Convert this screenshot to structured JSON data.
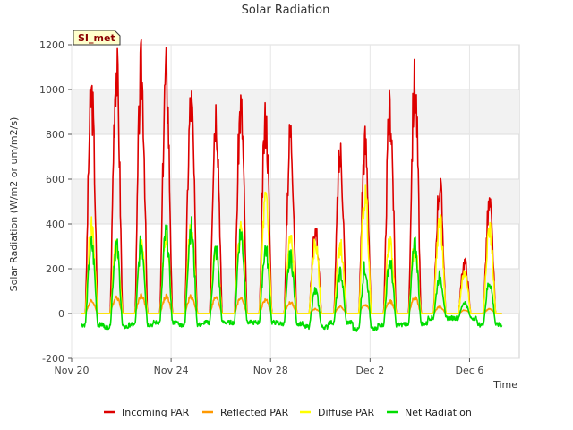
{
  "chart_data": {
    "type": "line",
    "title": "Solar Radiation",
    "xlabel": "Time",
    "ylabel": "Solar Radiation (W/m2 or um/m2/s)",
    "site_label": "SI_met",
    "ylim": [
      -200,
      1200
    ],
    "yticks": [
      -200,
      0,
      200,
      400,
      600,
      800,
      1000,
      1200
    ],
    "xlim": [
      0,
      18
    ],
    "xticks": [
      {
        "day": 0,
        "label": "Nov 20"
      },
      {
        "day": 4,
        "label": "Nov 24"
      },
      {
        "day": 8,
        "label": "Nov 28"
      },
      {
        "day": 12,
        "label": "Dec 2"
      },
      {
        "day": 16,
        "label": "Dec 6"
      }
    ],
    "x_unit": "days since Nov 20",
    "grid": true,
    "legend_position": "bottom",
    "daily_series_note": "x values are day midpoints of solar noon",
    "days": [
      0.8,
      1.8,
      2.8,
      3.8,
      4.8,
      5.8,
      6.8,
      7.8,
      8.8,
      9.8,
      10.8,
      11.8,
      12.8,
      13.8,
      14.8,
      15.8,
      16.8
    ],
    "series": [
      {
        "name": "Incoming PAR",
        "color": "#dd0000",
        "daily_peak": [
          970,
          1090,
          1075,
          1060,
          935,
          900,
          915,
          860,
          800,
          375,
          705,
          755,
          905,
          1025,
          570,
          230,
          480
        ]
      },
      {
        "name": "Reflected PAR",
        "color": "#ff9900",
        "daily_peak": [
          55,
          75,
          80,
          75,
          75,
          70,
          70,
          60,
          50,
          20,
          30,
          40,
          55,
          70,
          30,
          15,
          20
        ]
      },
      {
        "name": "Diffuse PAR",
        "color": "#ffff00",
        "daily_peak": [
          390,
          300,
          305,
          350,
          380,
          280,
          375,
          500,
          330,
          310,
          305,
          525,
          320,
          300,
          410,
          185,
          380
        ]
      },
      {
        "name": "Net Radiation",
        "color": "#00dd00",
        "daily_peak": [
          305,
          300,
          310,
          355,
          380,
          280,
          360,
          290,
          250,
          100,
          180,
          205,
          230,
          295,
          165,
          50,
          140
        ]
      }
    ],
    "net_night_min": [
      -50,
      -60,
      -50,
      -40,
      -50,
      -40,
      -40,
      -40,
      -45,
      -60,
      -40,
      -70,
      -50,
      -45,
      -20,
      -20,
      -50
    ]
  }
}
